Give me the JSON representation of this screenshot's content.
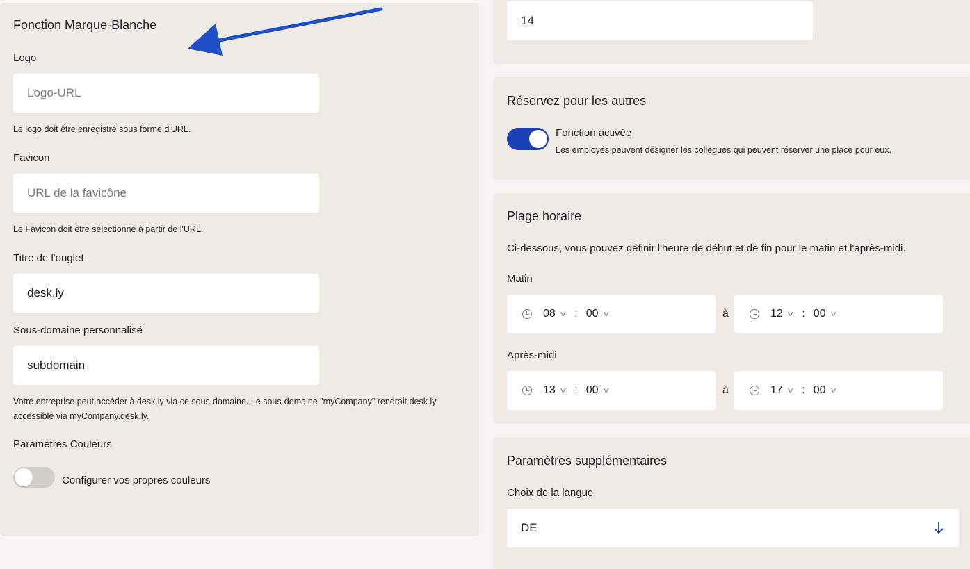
{
  "left": {
    "title": "Fonction Marque-Blanche",
    "logo": {
      "label": "Logo",
      "placeholder": "Logo-URL",
      "help": "Le logo doit être enregistré sous forme d'URL."
    },
    "favicon": {
      "label": "Favicon",
      "placeholder": "URL de la favicône",
      "help": "Le Favicon doit être sélectionné à partir de l'URL."
    },
    "tab_title": {
      "label": "Titre de l'onglet",
      "value": "desk.ly"
    },
    "subdomain": {
      "label": "Sous-domaine personnalisé",
      "value": "subdomain",
      "help": "Votre entreprise peut accéder à desk.ly via ce sous-domaine. Le sous-domaine \"myCompany\" rendrait desk.ly accessible via myCompany.desk.ly."
    },
    "colors": {
      "label": "Paramètres Couleurs",
      "toggle_label": "Configurer vos propres couleurs",
      "enabled": false
    }
  },
  "right": {
    "top_field_value": "14",
    "reserve": {
      "title": "Réservez pour les autres",
      "toggle_label": "Fonction activée",
      "toggle_desc": "Les employés peuvent désigner les collègues qui peuvent réserver une place pour eux.",
      "enabled": true
    },
    "timeslot": {
      "title": "Plage horaire",
      "desc": "Ci-dessous, vous pouvez définir l'heure de début et de fin pour le matin et l'après-midi.",
      "morning": {
        "label": "Matin",
        "from_h": "08",
        "from_m": "00",
        "to_h": "12",
        "to_m": "00"
      },
      "afternoon": {
        "label": "Après-midi",
        "from_h": "13",
        "from_m": "00",
        "to_h": "17",
        "to_m": "00"
      },
      "separator": "à",
      "colon": ":"
    },
    "extra": {
      "title": "Paramètres supplémentaires",
      "lang_label": "Choix de la langue",
      "lang_value": "DE"
    }
  },
  "annotation": {
    "arrow_color": "#1f4fc7"
  },
  "colors": {
    "accent": "#1b3fb5",
    "panel": "#eeebe7",
    "bg": "#f7f5f3"
  }
}
